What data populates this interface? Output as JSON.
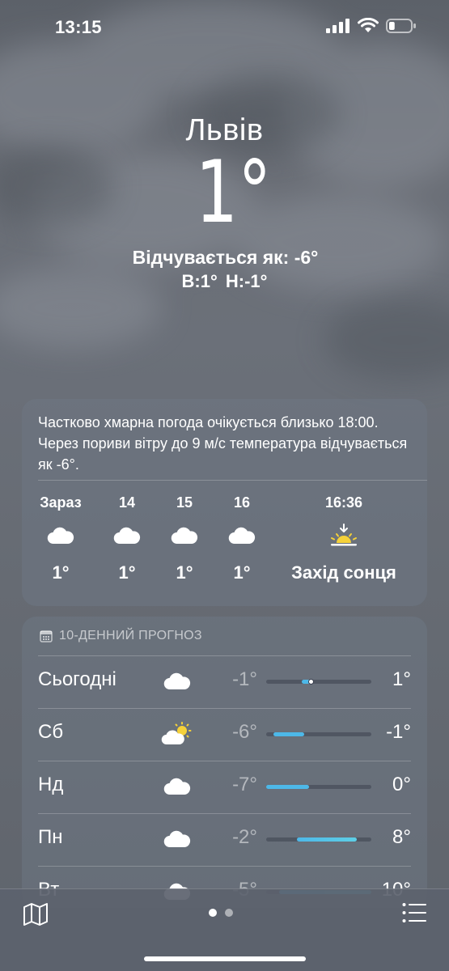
{
  "status": {
    "time": "13:15",
    "battery_level": 0.25
  },
  "hero": {
    "city": "Львів",
    "temp": "1°",
    "feels_like": "Відчувається як: -6°",
    "hi_lo": "В:1°  Н:-1°"
  },
  "hourly": {
    "summary": "Частково хмарна погода очікується близько 18:00. Через пориви вітру до 9 м/с температура відчувається як -6°.",
    "items": [
      {
        "label": "Зараз",
        "icon": "cloud-icon",
        "temp": "1°"
      },
      {
        "label": "14",
        "icon": "cloud-icon",
        "temp": "1°"
      },
      {
        "label": "15",
        "icon": "cloud-icon",
        "temp": "1°"
      },
      {
        "label": "16",
        "icon": "cloud-icon",
        "temp": "1°"
      }
    ],
    "sunset": {
      "label": "16:36",
      "icon": "sunset-icon",
      "text": "Захід сонця"
    }
  },
  "forecast": {
    "header": "10-ДЕННИЙ ПРОГНОЗ",
    "days": [
      {
        "day": "Сьогодні",
        "icon": "cloud-icon",
        "lo": "-1°",
        "hi": "1°",
        "bar_start": 0.34,
        "bar_end": 0.43,
        "current": 0.43
      },
      {
        "day": "Сб",
        "icon": "partly-sunny-icon",
        "lo": "-6°",
        "hi": "-1°",
        "bar_start": 0.07,
        "bar_end": 0.36
      },
      {
        "day": "Нд",
        "icon": "cloud-icon",
        "lo": "-7°",
        "hi": "0°",
        "bar_start": 0.0,
        "bar_end": 0.41
      },
      {
        "day": "Пн",
        "icon": "cloud-icon",
        "lo": "-2°",
        "hi": "8°",
        "bar_start": 0.29,
        "bar_end": 0.86
      },
      {
        "day": "Вт",
        "icon": "cloud-icon",
        "lo": "-5°",
        "hi": "10°",
        "bar_start": 0.12,
        "bar_end": 1.0
      }
    ]
  },
  "colors": {
    "bar_cool": "#4db8e8",
    "bar_mild": "#5ecfe6",
    "sun": "#f5d13a"
  }
}
